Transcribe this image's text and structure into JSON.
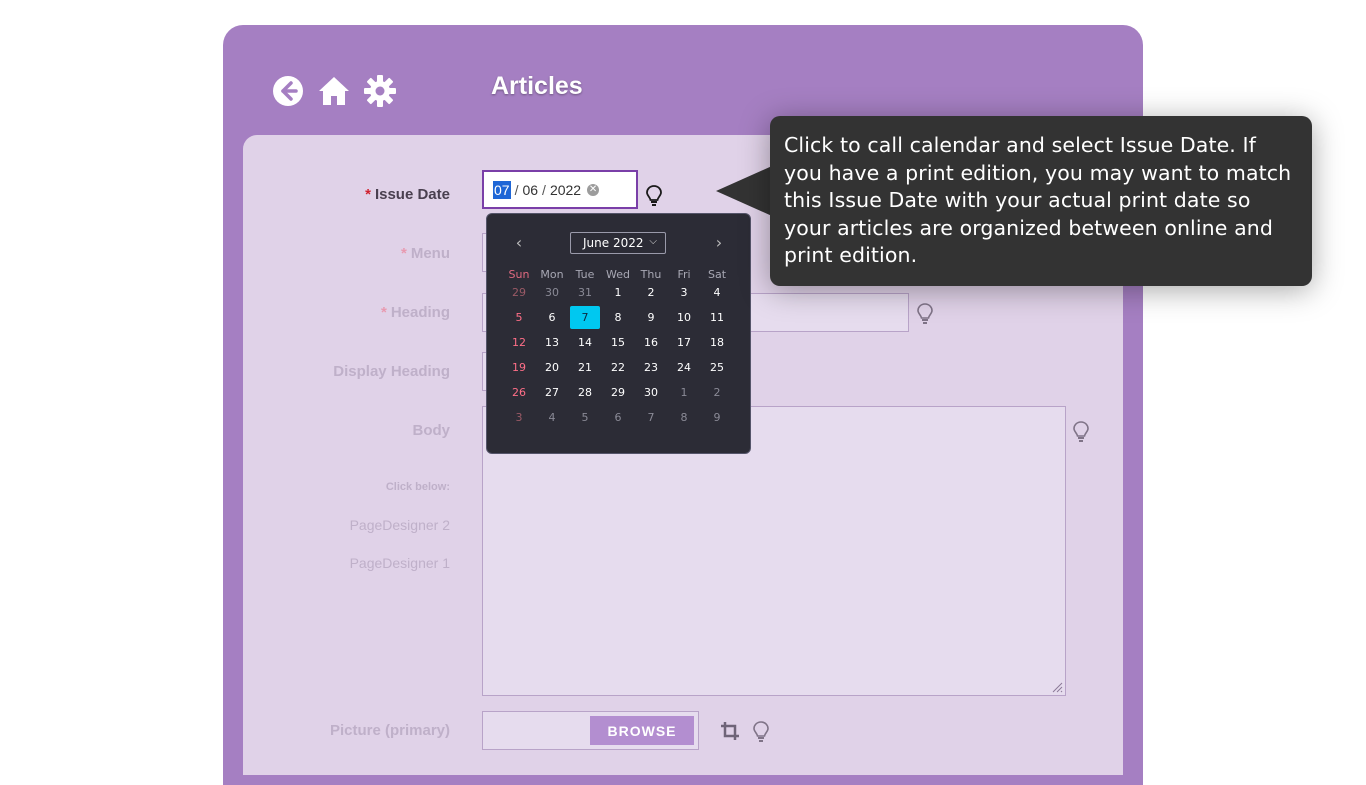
{
  "header": {
    "title": "Articles",
    "icons": [
      "back-arrow-icon",
      "home-icon",
      "gear-icon"
    ]
  },
  "form": {
    "issue_date": {
      "label": "Issue Date",
      "required_mark": "*",
      "month": "07",
      "day": "06",
      "year": "2022",
      "separator": "/"
    },
    "menu": {
      "label": "Menu",
      "required_mark": "*"
    },
    "heading": {
      "label": "Heading",
      "required_mark": "*"
    },
    "display_heading": {
      "label": "Display Heading"
    },
    "body": {
      "label": "Body"
    },
    "click_below": "Click below:",
    "page_designer_2": "PageDesigner 2",
    "page_designer_1": "PageDesigner 1",
    "picture": {
      "label": "Picture (primary)",
      "browse_label": "BROWSE"
    }
  },
  "calendar": {
    "month_label": "June 2022",
    "prev_icon": "chevron-left-icon",
    "next_icon": "chevron-right-icon",
    "weekdays": [
      "Sun",
      "Mon",
      "Tue",
      "Wed",
      "Thu",
      "Fri",
      "Sat"
    ],
    "weeks": [
      [
        "29",
        "30",
        "31",
        "1",
        "2",
        "3",
        "4"
      ],
      [
        "5",
        "6",
        "7",
        "8",
        "9",
        "10",
        "11"
      ],
      [
        "12",
        "13",
        "14",
        "15",
        "16",
        "17",
        "18"
      ],
      [
        "19",
        "20",
        "21",
        "22",
        "23",
        "24",
        "25"
      ],
      [
        "26",
        "27",
        "28",
        "29",
        "30",
        "1",
        "2"
      ],
      [
        "3",
        "4",
        "5",
        "6",
        "7",
        "8",
        "9"
      ]
    ],
    "selected_day": "7",
    "selected_color": "#00c8f0"
  },
  "tooltip": {
    "text": "Click to call calendar and select Issue Date. If you have a print edition, you may want to match this Issue Date with your actual print date so your articles are organized between online and print edition."
  },
  "colors": {
    "frame": "#a57fc2",
    "content": "#e0d2e8",
    "required": "#d0202e",
    "tooltip_bg": "#333333"
  }
}
